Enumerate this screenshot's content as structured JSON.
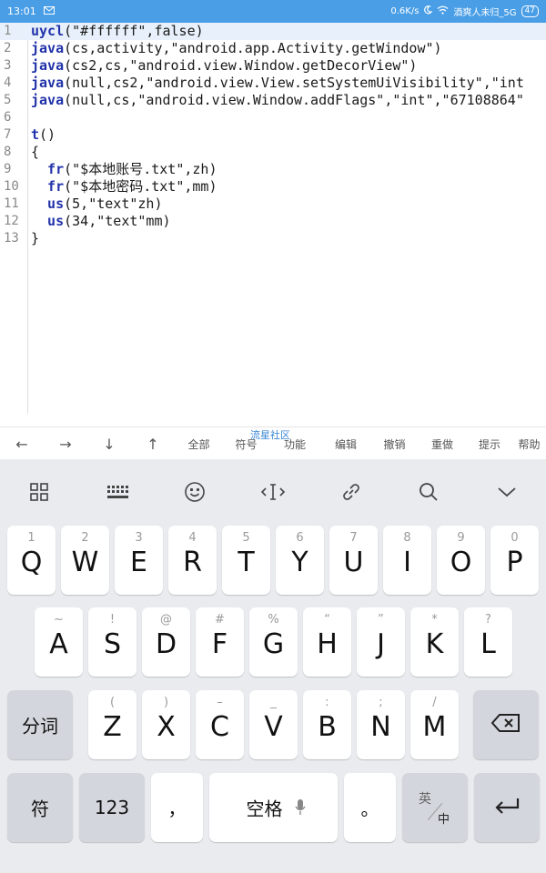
{
  "status_bar": {
    "time": "13:01",
    "notif_icon": "mail-icon",
    "speed": "0.6K/s",
    "wifi_name": "酒爽人未归_5G",
    "battery": "47"
  },
  "editor": {
    "lines": [
      {
        "num": "1",
        "kw": "uycl",
        "rest": "(\"#ffffff\",false)"
      },
      {
        "num": "2",
        "kw": "java",
        "rest": "(cs,activity,\"android.app.Activity.getWindow\")"
      },
      {
        "num": "3",
        "kw": "java",
        "rest": "(cs2,cs,\"android.view.Window.getDecorView\")"
      },
      {
        "num": "4",
        "kw": "java",
        "rest": "(null,cs2,\"android.view.View.setSystemUiVisibility\",\"int"
      },
      {
        "num": "5",
        "kw": "java",
        "rest": "(null,cs,\"android.view.Window.addFlags\",\"int\",\"67108864\""
      },
      {
        "num": "6",
        "kw": "",
        "rest": ""
      },
      {
        "num": "7",
        "kw": "t",
        "rest": "()"
      },
      {
        "num": "8",
        "kw": "",
        "rest": "{"
      },
      {
        "num": "9",
        "kw": "  fr",
        "rest": "(\"$本地账号.txt\",zh)"
      },
      {
        "num": "10",
        "kw": "  fr",
        "rest": "(\"$本地密码.txt\",mm)"
      },
      {
        "num": "11",
        "kw": "  us",
        "rest": "(5,\"text\"zh)"
      },
      {
        "num": "12",
        "kw": "  us",
        "rest": "(34,\"text\"mm)"
      },
      {
        "num": "13",
        "kw": "",
        "rest": "}"
      }
    ]
  },
  "shortcut_bar": {
    "items": [
      "←",
      "→",
      "↓",
      "↑",
      "全部",
      "符号",
      "功能",
      "编辑",
      "撤销",
      "重做",
      "提示",
      "帮助"
    ],
    "watermark": "流星社区"
  },
  "keyboard": {
    "toolbar": [
      "grid-icon",
      "keyboard-icon",
      "emoji-icon",
      "cursor-icon",
      "link-icon",
      "search-icon",
      "chevron-down-icon"
    ],
    "row1": [
      {
        "main": "Q",
        "sub": "1"
      },
      {
        "main": "W",
        "sub": "2"
      },
      {
        "main": "E",
        "sub": "3"
      },
      {
        "main": "R",
        "sub": "4"
      },
      {
        "main": "T",
        "sub": "5"
      },
      {
        "main": "Y",
        "sub": "6"
      },
      {
        "main": "U",
        "sub": "7"
      },
      {
        "main": "I",
        "sub": "8"
      },
      {
        "main": "O",
        "sub": "9"
      },
      {
        "main": "P",
        "sub": "0"
      }
    ],
    "row2": [
      {
        "main": "A",
        "sub": "~"
      },
      {
        "main": "S",
        "sub": "!"
      },
      {
        "main": "D",
        "sub": "@"
      },
      {
        "main": "F",
        "sub": "#"
      },
      {
        "main": "G",
        "sub": "%"
      },
      {
        "main": "H",
        "sub": "“"
      },
      {
        "main": "J",
        "sub": "”"
      },
      {
        "main": "K",
        "sub": "*"
      },
      {
        "main": "L",
        "sub": "?"
      }
    ],
    "row3": [
      {
        "main": "Z",
        "sub": "("
      },
      {
        "main": "X",
        "sub": ")"
      },
      {
        "main": "C",
        "sub": "–"
      },
      {
        "main": "V",
        "sub": "_"
      },
      {
        "main": "B",
        "sub": ":"
      },
      {
        "main": "N",
        "sub": ";"
      },
      {
        "main": "M",
        "sub": "/"
      }
    ],
    "fenci_label": "分词",
    "fu_label": "符",
    "num_label": "123",
    "comma_label": "，",
    "space_label": "空格",
    "period_label": "。",
    "lang_top": "英",
    "lang_bottom": "中"
  }
}
